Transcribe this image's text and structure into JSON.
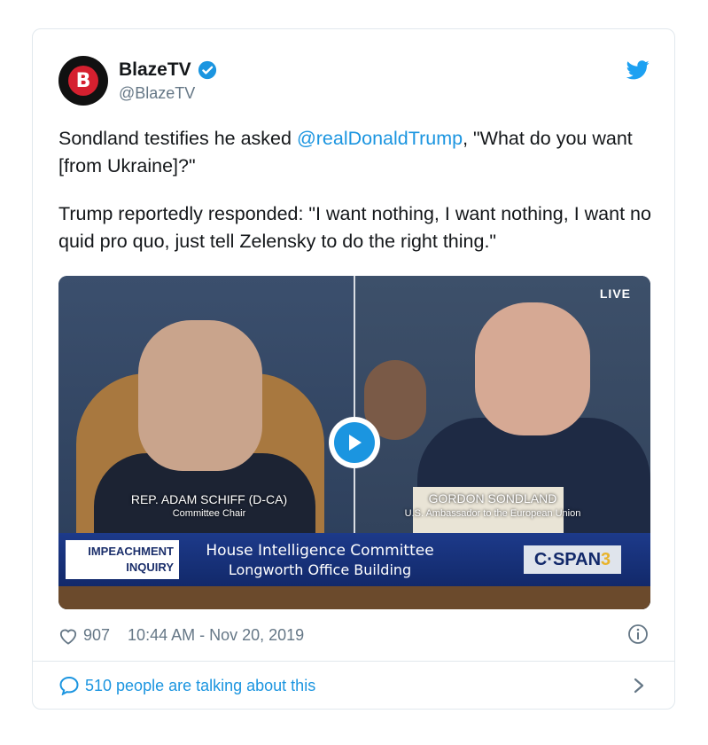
{
  "account": {
    "display_name": "BlazeTV",
    "handle": "@BlazeTV",
    "avatar_letter": "B"
  },
  "tweet": {
    "para1_before": "Sondland testifies he asked ",
    "mention": "@realDonaldTrump",
    "para1_after": ", \"What do you want [from Ukraine]?\"",
    "para2": "Trump reportedly responded: \"I want nothing, I want nothing, I want no quid pro quo, just tell Zelensky to do the right thing.\""
  },
  "video": {
    "live_label": "LIVE",
    "left_caption_name": "REP. ADAM SCHIFF (D-CA)",
    "left_caption_role": "Committee Chair",
    "right_caption_name": "GORDON SONDLAND",
    "right_caption_role": "U.S. Ambassador to the European Union",
    "banner_tag_line1": "IMPEACHMENT",
    "banner_tag_line2": "INQUIRY",
    "banner_line1": "House Intelligence Committee",
    "banner_line2": "Longworth Office Building",
    "network_main": "C·SPAN",
    "network_number": "3"
  },
  "meta": {
    "likes": "907",
    "timestamp": "10:44 AM - Nov 20, 2019"
  },
  "footer": {
    "talking": "510 people are talking about this"
  },
  "colors": {
    "link": "#1b95e0",
    "muted": "#657786",
    "brand_red": "#d5202f"
  },
  "icons": [
    "verified-icon",
    "twitter-bird-icon",
    "play-icon",
    "heart-icon",
    "info-icon",
    "speech-bubble-icon",
    "chevron-right-icon"
  ]
}
